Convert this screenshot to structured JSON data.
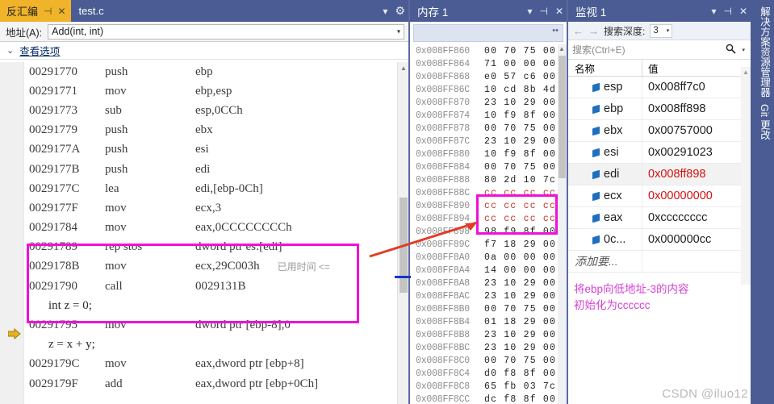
{
  "disassembly": {
    "tab_active": "反汇编",
    "tab_active_pin": "⊣",
    "tab_active_close": "✕",
    "tab_inactive": "test.c",
    "dropdown_icon": "▾",
    "gear_icon": "⚙",
    "address_label": "地址(A):",
    "address_value": "Add(int, int)",
    "address_caret": "▾",
    "view_options_chevron": "⌄",
    "view_options_label": "查看选项",
    "elapsed_badge": "已用时间 <=",
    "lines": [
      {
        "addr": "00291770",
        "mnemonic": "push",
        "operands": "ebp"
      },
      {
        "addr": "00291771",
        "mnemonic": "mov",
        "operands": "ebp,esp"
      },
      {
        "addr": "00291773",
        "mnemonic": "sub",
        "operands": "esp,0CCh"
      },
      {
        "addr": "00291779",
        "mnemonic": "push",
        "operands": "ebx"
      },
      {
        "addr": "0029177A",
        "mnemonic": "push",
        "operands": "esi"
      },
      {
        "addr": "0029177B",
        "mnemonic": "push",
        "operands": "edi"
      },
      {
        "addr": "0029177C",
        "mnemonic": "lea",
        "operands": "edi,[ebp-0Ch]"
      },
      {
        "addr": "0029177F",
        "mnemonic": "mov",
        "operands": "ecx,3"
      },
      {
        "addr": "00291784",
        "mnemonic": "mov",
        "operands": "eax,0CCCCCCCCh"
      },
      {
        "addr": "00291789",
        "mnemonic": "rep stos",
        "operands": "dword ptr es:[edi]"
      },
      {
        "addr": "0029178B",
        "mnemonic": "mov",
        "operands": "ecx,29C003h",
        "current": true,
        "elapsed": true
      },
      {
        "addr": "00291790",
        "mnemonic": "call",
        "operands": "0029131B"
      },
      {
        "source": "int z = 0;"
      },
      {
        "addr": "00291795",
        "mnemonic": "mov",
        "operands": "dword ptr [ebp-8],0"
      },
      {
        "source": "z = x + y;"
      },
      {
        "addr": "0029179C",
        "mnemonic": "mov",
        "operands": "eax,dword ptr [ebp+8]"
      },
      {
        "addr": "0029179F",
        "mnemonic": "add",
        "operands": "eax,dword ptr [ebp+0Ch]"
      }
    ]
  },
  "memory": {
    "title": "内存 1",
    "dropdown_icon": "▾",
    "pin_icon": "⊣",
    "close_icon": "✕",
    "toolbar_dots": "••",
    "rows": [
      {
        "addr": "0x008FF860",
        "bytes": "00 70 75 00"
      },
      {
        "addr": "0x008FF864",
        "bytes": "71 00 00 00"
      },
      {
        "addr": "0x008FF868",
        "bytes": "e0 57 c6 00"
      },
      {
        "addr": "0x008FF86C",
        "bytes": "10 cd 8b 4d"
      },
      {
        "addr": "0x008FF870",
        "bytes": "23 10 29 00"
      },
      {
        "addr": "0x008FF874",
        "bytes": "10 f9 8f 00"
      },
      {
        "addr": "0x008FF878",
        "bytes": "00 70 75 00"
      },
      {
        "addr": "0x008FF87C",
        "bytes": "23 10 29 00"
      },
      {
        "addr": "0x008FF880",
        "bytes": "10 f9 8f 00"
      },
      {
        "addr": "0x008FF884",
        "bytes": "00 70 75 00"
      },
      {
        "addr": "0x008FF888",
        "bytes": "80 2d 10 7c"
      },
      {
        "addr": "0x008FF88C",
        "bytes": "cc cc cc cc",
        "highlight": true
      },
      {
        "addr": "0x008FF890",
        "bytes": "cc cc cc cc",
        "highlight": true
      },
      {
        "addr": "0x008FF894",
        "bytes": "cc cc cc cc",
        "highlight": true
      },
      {
        "addr": "0x008FF898",
        "bytes": "98 f9 8f 00"
      },
      {
        "addr": "0x008FF89C",
        "bytes": "f7 18 29 00"
      },
      {
        "addr": "0x008FF8A0",
        "bytes": "0a 00 00 00"
      },
      {
        "addr": "0x008FF8A4",
        "bytes": "14 00 00 00"
      },
      {
        "addr": "0x008FF8A8",
        "bytes": "23 10 29 00"
      },
      {
        "addr": "0x008FF8AC",
        "bytes": "23 10 29 00"
      },
      {
        "addr": "0x008FF8B0",
        "bytes": "00 70 75 00"
      },
      {
        "addr": "0x008FF8B4",
        "bytes": "01 18 29 00"
      },
      {
        "addr": "0x008FF8B8",
        "bytes": "23 10 29 00"
      },
      {
        "addr": "0x008FF8BC",
        "bytes": "23 10 29 00"
      },
      {
        "addr": "0x008FF8C0",
        "bytes": "00 70 75 00"
      },
      {
        "addr": "0x008FF8C4",
        "bytes": "d0 f8 8f 00"
      },
      {
        "addr": "0x008FF8C8",
        "bytes": "65 fb 03 7c"
      },
      {
        "addr": "0x008FF8CC",
        "bytes": "dc f8 8f 00"
      }
    ]
  },
  "watch": {
    "title": "监视 1",
    "dropdown_icon": "▾",
    "pin_icon": "⊣",
    "close_icon": "✕",
    "back_icon": "←",
    "forward_icon": "→",
    "depth_label": "搜索深度:",
    "depth_value": "3",
    "depth_caret": "▾",
    "search_placeholder": "搜索(Ctrl+E)",
    "search_icon": "⌕",
    "search_caret": "▾",
    "col_name": "名称",
    "col_value": "值",
    "rows": [
      {
        "name": "esp",
        "value": "0x008ff7c0"
      },
      {
        "name": "ebp",
        "value": "0x008ff898"
      },
      {
        "name": "ebx",
        "value": "0x00757000"
      },
      {
        "name": "esi",
        "value": "0x00291023"
      },
      {
        "name": "edi",
        "value": "0x008ff898",
        "value_red": true,
        "selected": true
      },
      {
        "name": "ecx",
        "value": "0x00000000",
        "value_red": true
      },
      {
        "name": "eax",
        "value": "0xcccccccc"
      },
      {
        "name": "0c...",
        "value": "0x000000cc"
      }
    ],
    "add_row_placeholder": "添加要...",
    "note_line1": "将ebp向低地址-3的内容",
    "note_line2": "初始化为cccccc"
  },
  "rail": {
    "items": [
      "解决方案资源管理器",
      "Git 更改"
    ]
  },
  "watermark": "CSDN @iluo12",
  "colors": {
    "accent_magenta": "#f20fd8",
    "accent_red": "#d51010",
    "titlebar_blue": "#4a5c93",
    "tab_gold": "#f0b32a",
    "note_purple": "#d63fd6"
  }
}
